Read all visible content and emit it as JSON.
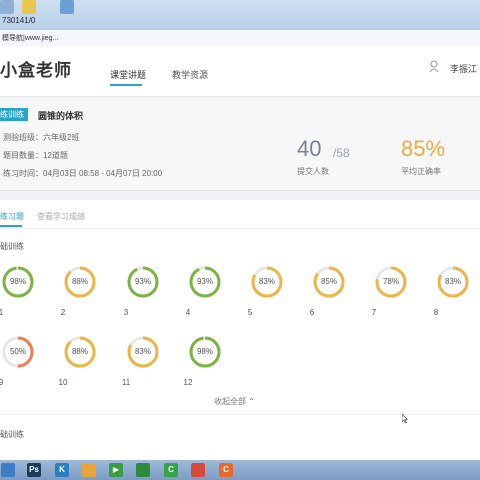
{
  "browser": {
    "tab_text": "730141/0",
    "address": "模导航|www.jieg..."
  },
  "header": {
    "logo": "小盒老师",
    "nav": [
      {
        "label": "课堂讲题"
      },
      {
        "label": "教学资源"
      }
    ],
    "user_name": "李振江"
  },
  "exercise": {
    "badge": "练训练",
    "title": "圆锥的体积",
    "class_info": "测验班级：六年级2班",
    "question_count": "题目数量：12道题",
    "time": "练习时间：04月03日 08:58 - 04月07日 20:00",
    "submitted": "40",
    "total": "/58",
    "submitted_label": "提交人数",
    "accuracy": "85%",
    "accuracy_label": "平均正确率"
  },
  "tabs": [
    {
      "label": "练习题"
    },
    {
      "label": "查看学习成绩"
    }
  ],
  "section_title": "础训练",
  "section_title_2": "础训练",
  "collapse_label": "收起全部",
  "questions": [
    {
      "num": "1",
      "pct": "98%",
      "value": 98,
      "color": "#7cb342"
    },
    {
      "num": "2",
      "pct": "88%",
      "value": 88,
      "color": "#f0b446"
    },
    {
      "num": "3",
      "pct": "93%",
      "value": 93,
      "color": "#7cb342"
    },
    {
      "num": "4",
      "pct": "93%",
      "value": 93,
      "color": "#7cb342"
    },
    {
      "num": "5",
      "pct": "83%",
      "value": 83,
      "color": "#f0b446"
    },
    {
      "num": "6",
      "pct": "85%",
      "value": 85,
      "color": "#f0b446"
    },
    {
      "num": "7",
      "pct": "78%",
      "value": 78,
      "color": "#f0b446"
    },
    {
      "num": "8",
      "pct": "83%",
      "value": 83,
      "color": "#f0b446"
    },
    {
      "num": "9",
      "pct": "50%",
      "value": 50,
      "color": "#ee7d58"
    },
    {
      "num": "10",
      "pct": "88%",
      "value": 88,
      "color": "#f0b446"
    },
    {
      "num": "11",
      "pct": "83%",
      "value": 83,
      "color": "#f0b446"
    },
    {
      "num": "12",
      "pct": "98%",
      "value": 98,
      "color": "#7cb342"
    }
  ],
  "taskbar": [
    {
      "name": "ps",
      "label": "Ps",
      "color": "#1b3c5a"
    },
    {
      "name": "k",
      "label": "K",
      "color": "#2a7fc0"
    },
    {
      "name": "pinwheel",
      "label": "",
      "color": "#e7a43b"
    },
    {
      "name": "player",
      "label": "▶",
      "color": "#3b9c47"
    },
    {
      "name": "camtasia",
      "label": "",
      "color": "#2d8a3a"
    },
    {
      "name": "green-c",
      "label": "C",
      "color": "#3aa34a"
    },
    {
      "name": "chrome",
      "label": "",
      "color": "#d64a3b"
    },
    {
      "name": "orange-c",
      "label": "C",
      "color": "#e8692e"
    }
  ]
}
